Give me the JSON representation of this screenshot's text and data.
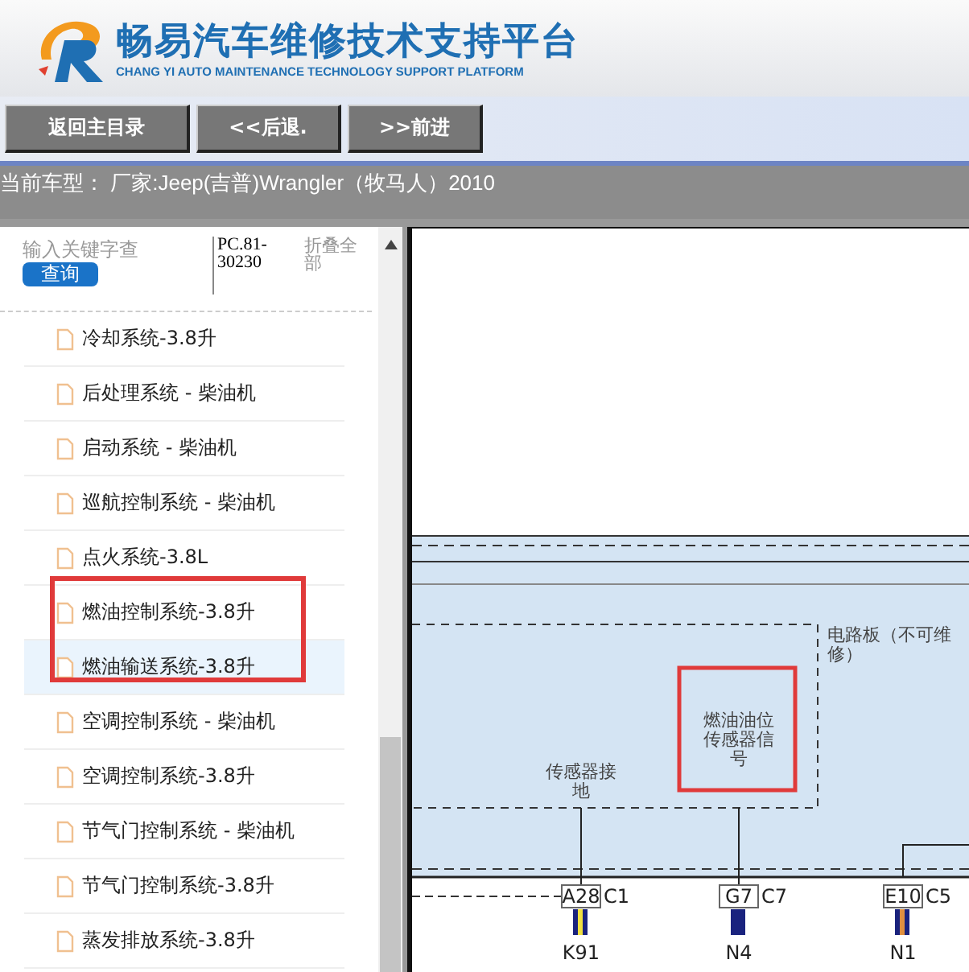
{
  "header": {
    "title": "畅易汽车维修技术支持平台",
    "subtitle": "CHANG YI AUTO MAINTENANCE TECHNOLOGY SUPPORT PLATFORM"
  },
  "nav_buttons": [
    "返回主目录",
    "<<后退.",
    ">>前进"
  ],
  "vehicle_bar": {
    "text": "当前车型： 厂家:Jeep(吉普)Wrangler（牧马人）2010"
  },
  "sidebar": {
    "search": {
      "placeholder": "输入关键字查"
    },
    "search_button": "查询",
    "code": "PC.81-30230",
    "collapse_all": "折叠全部",
    "items": [
      {
        "label": "冷却系统-3.8升",
        "selected": false
      },
      {
        "label": "后处理系统 - 柴油机",
        "selected": false
      },
      {
        "label": "启动系统 - 柴油机",
        "selected": false
      },
      {
        "label": "巡航控制系统 - 柴油机",
        "selected": false
      },
      {
        "label": "点火系统-3.8L",
        "selected": false
      },
      {
        "label": "燃油控制系统-3.8升",
        "selected": false
      },
      {
        "label": "燃油输送系统-3.8升",
        "selected": true
      },
      {
        "label": "空调控制系统 - 柴油机",
        "selected": false
      },
      {
        "label": "空调控制系统-3.8升",
        "selected": false
      },
      {
        "label": "节气门控制系统 - 柴油机",
        "selected": false
      },
      {
        "label": "节气门控制系统-3.8升",
        "selected": false
      },
      {
        "label": "蒸发排放系统-3.8升",
        "selected": false
      }
    ]
  },
  "diagram": {
    "board_label": [
      "电路板（不可维",
      "修）"
    ],
    "ground_label": [
      "传感器接",
      "地"
    ],
    "signal_label": [
      "燃油油位",
      "传感器信",
      "号"
    ],
    "connectors": [
      {
        "pin": "A28",
        "connector": "C1",
        "wire": "K91",
        "color": "#f0e040"
      },
      {
        "pin": "G7",
        "connector": "C7",
        "wire": "N4",
        "color": "#1a237e"
      },
      {
        "pin": "E10",
        "connector": "C5",
        "wire": "N1",
        "color": "#e09040"
      }
    ]
  }
}
